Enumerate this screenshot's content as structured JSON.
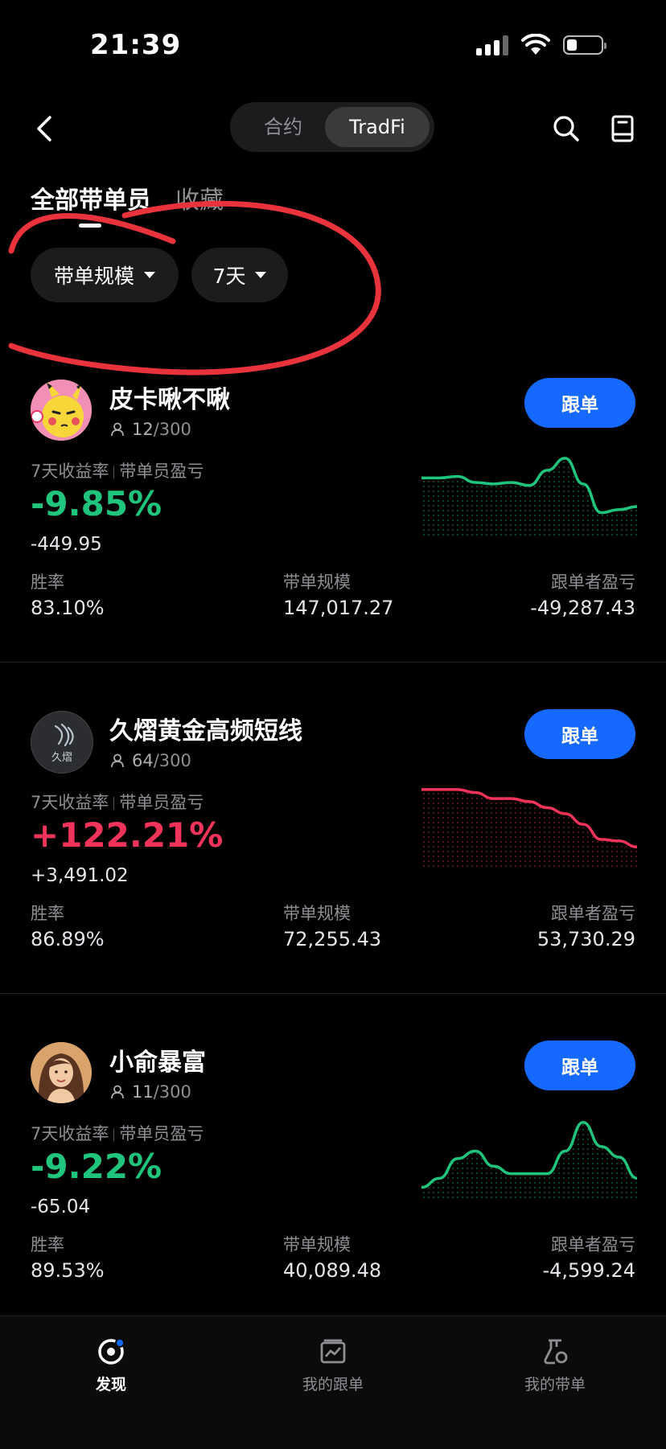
{
  "status": {
    "time": "21:39"
  },
  "header": {
    "segments": [
      "合约",
      "TradFi"
    ],
    "active_segment": "TradFi",
    "icons": [
      "back-icon",
      "search-icon",
      "book-icon"
    ]
  },
  "tabs": {
    "all": "全部带单员",
    "favorites": "收藏"
  },
  "filters": {
    "scale": "带单规模",
    "period": "7天"
  },
  "card_labels": {
    "follow_button": "跟单",
    "metric_roi": "7天收益率",
    "metric_pnl": "带单员盈亏",
    "win_rate": "胜率",
    "scale": "带单规模",
    "follower_pnl": "跟单者盈亏"
  },
  "traders": [
    {
      "name": "皮卡啾不啾",
      "followers": "12",
      "max_followers": "/300",
      "roi": "-9.85%",
      "pnl": "-449.95",
      "win_rate": "83.10%",
      "scale": "147,017.27",
      "follower_pnl": "-49,287.43",
      "trend": "down",
      "color": "#1fc47d",
      "avatar": "pikachu-avatar",
      "spark": [
        0.28,
        0.28,
        0.26,
        0.34,
        0.36,
        0.34,
        0.38,
        0.18,
        0.02,
        0.36,
        0.74,
        0.7,
        0.66
      ]
    },
    {
      "name": "久熠黄金高频短线",
      "followers": "64",
      "max_followers": "/300",
      "roi": "+122.21%",
      "pnl": "+3,491.02",
      "win_rate": "86.89%",
      "scale": "72,255.43",
      "follower_pnl": "53,730.29",
      "trend": "up",
      "color": "#f0335a",
      "avatar": "logo-avatar",
      "avatar_text": "久熠",
      "spark": [
        0.02,
        0.02,
        0.02,
        0.06,
        0.14,
        0.14,
        0.18,
        0.26,
        0.34,
        0.48,
        0.68,
        0.7,
        0.78
      ]
    },
    {
      "name": "小俞暴富",
      "followers": "11",
      "max_followers": "/300",
      "roi": "-9.22%",
      "pnl": "-65.04",
      "win_rate": "89.53%",
      "scale": "40,089.48",
      "follower_pnl": "-4,599.24",
      "trend": "down",
      "color": "#1fc47d",
      "avatar": "portrait-avatar",
      "spark": [
        0.9,
        0.78,
        0.52,
        0.42,
        0.62,
        0.72,
        0.72,
        0.72,
        0.42,
        0.04,
        0.36,
        0.5,
        0.78
      ]
    }
  ],
  "nav": [
    {
      "label": "发现",
      "icon": "discover-icon",
      "active": true
    },
    {
      "label": "我的跟单",
      "icon": "my-copy-icon",
      "active": false
    },
    {
      "label": "我的带单",
      "icon": "my-lead-icon",
      "active": false
    }
  ],
  "annotation_color": "#e8323c"
}
